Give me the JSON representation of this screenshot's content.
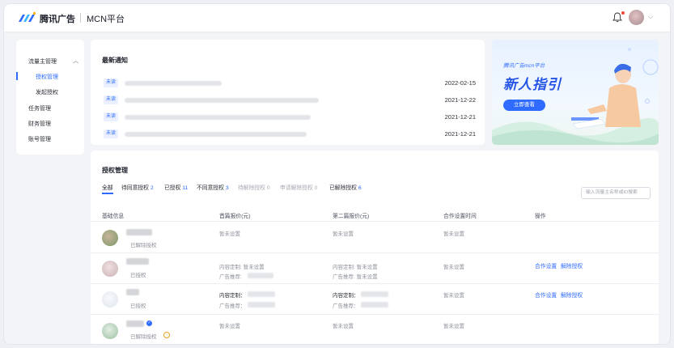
{
  "header": {
    "brand": "腾讯广告",
    "platform": "MCN平台"
  },
  "sidebar": {
    "items": [
      {
        "label": "流量主管理"
      },
      {
        "label": "授权管理",
        "active": true
      },
      {
        "label": "发起授权"
      },
      {
        "label": "任务管理"
      },
      {
        "label": "财务管理"
      },
      {
        "label": "账号管理"
      }
    ]
  },
  "notices": {
    "title": "最新通知",
    "tag": "未读",
    "rows": [
      {
        "date": "2022-02-15"
      },
      {
        "date": "2021-12-22"
      },
      {
        "date": "2021-12-21"
      },
      {
        "date": "2021-12-21"
      }
    ]
  },
  "banner": {
    "subtitle": "腾讯广告mcn平台",
    "title": "新人指引",
    "button": "立即查看"
  },
  "auth": {
    "title": "授权管理",
    "tabs": [
      {
        "label": "全部",
        "count": ""
      },
      {
        "label": "待同意授权",
        "count": "2"
      },
      {
        "label": "已授权",
        "count": "11"
      },
      {
        "label": "不同意授权",
        "count": "3"
      },
      {
        "label": "待解除授权",
        "count": "0"
      },
      {
        "label": "申请解除授权",
        "count": "0"
      },
      {
        "label": "已解除授权",
        "count": "6"
      }
    ],
    "search_placeholder": "输入流量主名称或ID搜索",
    "columns": [
      "基础信息",
      "首篇报价(元)",
      "第二篇报价(元)",
      "合作设置时间",
      "操作"
    ],
    "unset": "暂未设置",
    "content_custom": "内容定制",
    "ad_recommend": "广告推荐",
    "content_custom_colon": "内容定制：",
    "ad_recommend_colon": "广告推荐：",
    "action_setting": "合作设置",
    "action_revoke": "解除授权",
    "rows": [
      {
        "status": "已解除授权"
      },
      {
        "status": "已授权"
      },
      {
        "status": "已授权"
      },
      {
        "status": "已解除授权"
      }
    ]
  },
  "colors": {
    "accent": "#2f6bff",
    "alert_dot": "#f5483b"
  }
}
